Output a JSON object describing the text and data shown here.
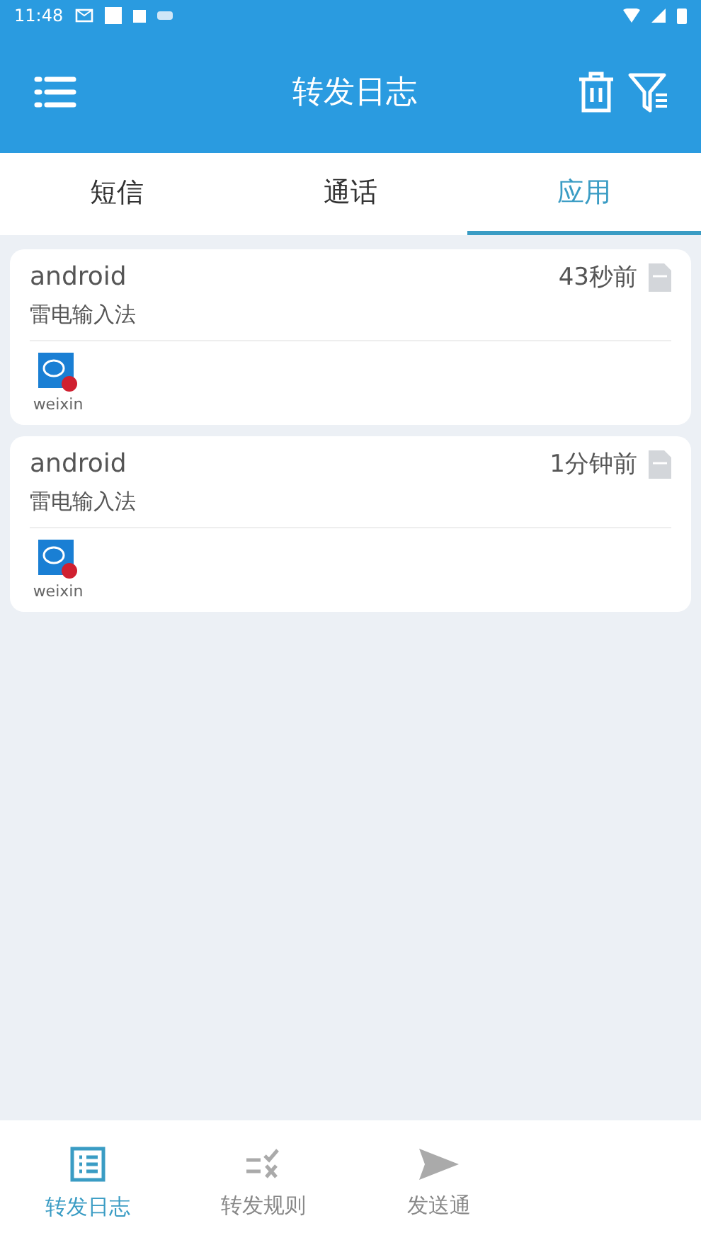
{
  "status_bar": {
    "time": "11:48"
  },
  "app_bar": {
    "title": "转发日志"
  },
  "tabs": [
    {
      "label": "短信",
      "selected": false
    },
    {
      "label": "通话",
      "selected": false
    },
    {
      "label": "应用",
      "selected": true
    }
  ],
  "logs": [
    {
      "source": "android",
      "time": "43秒前",
      "content": "雷电输入法",
      "app": "weixin"
    },
    {
      "source": "android",
      "time": "1分钟前",
      "content": "雷电输入法",
      "app": "weixin"
    }
  ],
  "bottom_nav": [
    {
      "label": "转发日志",
      "kind": "log",
      "selected": true
    },
    {
      "label": "转发规则",
      "kind": "rules",
      "selected": false
    },
    {
      "label": "发送通",
      "kind": "send",
      "selected": false
    }
  ]
}
